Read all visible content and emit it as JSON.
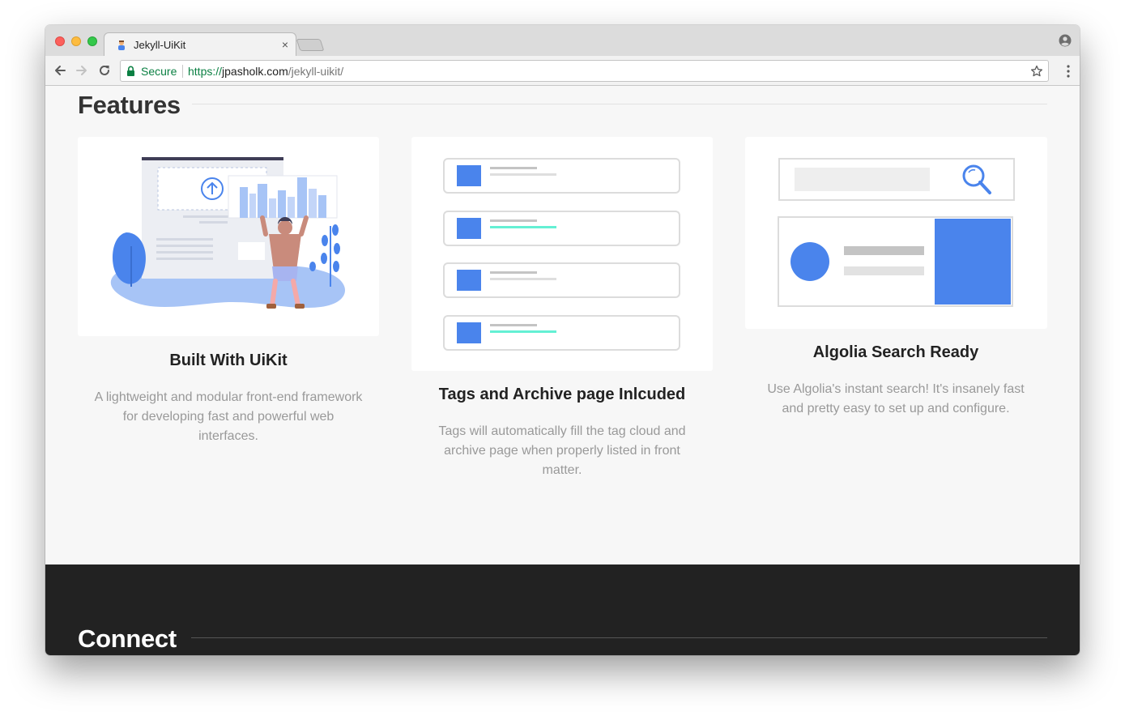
{
  "browser": {
    "tab": {
      "title": "Jekyll-UiKit",
      "close_glyph": "×"
    },
    "address_bar": {
      "secure_label": "Secure",
      "url_scheme": "https://",
      "url_host": "jpasholk.com",
      "url_path": "/jekyll-uikit/"
    },
    "icons": [
      "back-arrow-icon",
      "forward-arrow-icon",
      "reload-icon",
      "lock-icon",
      "star-icon",
      "menu-icon",
      "profile-icon"
    ]
  },
  "features": {
    "heading": "Features",
    "cards": [
      {
        "title": "Built With UiKit",
        "description": "A lightweight and modular front-end framework for developing fast and powerful web interfaces."
      },
      {
        "title": "Tags and Archive page Inlcuded",
        "description": "Tags will automatically fill the tag cloud and archive page when properly listed in front matter."
      },
      {
        "title": "Algolia Search Ready",
        "description": "Use Algolia's instant search! It's insanely fast and pretty easy to set up and configure."
      }
    ]
  },
  "connect": {
    "heading": "Connect"
  },
  "colors": {
    "accent_blue": "#4a84ec",
    "accent_teal": "#64f0d4",
    "footer_bg": "#222222",
    "page_bg": "#f7f7f7",
    "secure_green": "#0b8043"
  }
}
